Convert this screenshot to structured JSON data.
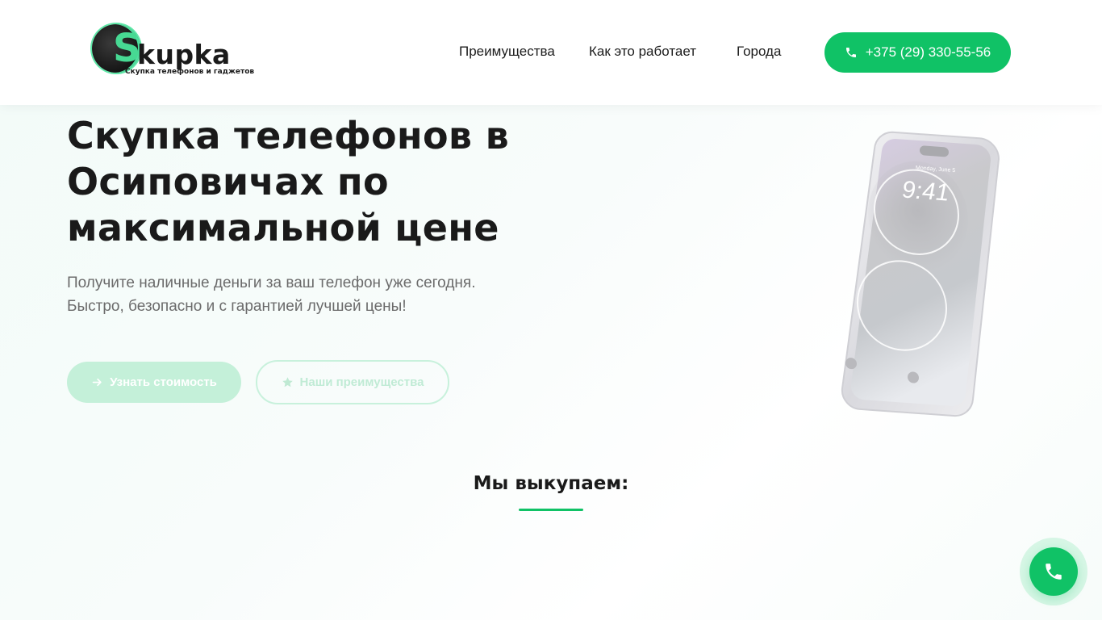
{
  "brand": {
    "logo_letter": "S",
    "logo_word": "kupka",
    "logo_tagline": "Скупка телефонов и гаджетов",
    "accent_color": "#10c266",
    "logo_accent_color": "#47d993"
  },
  "nav": {
    "items": [
      {
        "label": "Преимущества"
      },
      {
        "label": "Как это работает"
      },
      {
        "label": "Города"
      }
    ],
    "phone_label": "+375 (29) 330-55-56"
  },
  "hero": {
    "title": "Скупка телефонов в Осиповичах по максимальной цене",
    "subtitle_line1": "Получите наличные деньги за ваш телефон уже сегодня.",
    "subtitle_line2": "Быстро, безопасно и с гарантией лучшей цены!",
    "primary_button": "Узнать стоимость",
    "secondary_button": "Наши преимущества"
  },
  "phone_image": {
    "time": "9:41",
    "date": "Monday, June 5"
  },
  "section": {
    "title": "Мы выкупаем:"
  },
  "icons": {
    "phone": "phone-icon",
    "arrow": "arrow-right-icon",
    "star": "star-icon"
  }
}
